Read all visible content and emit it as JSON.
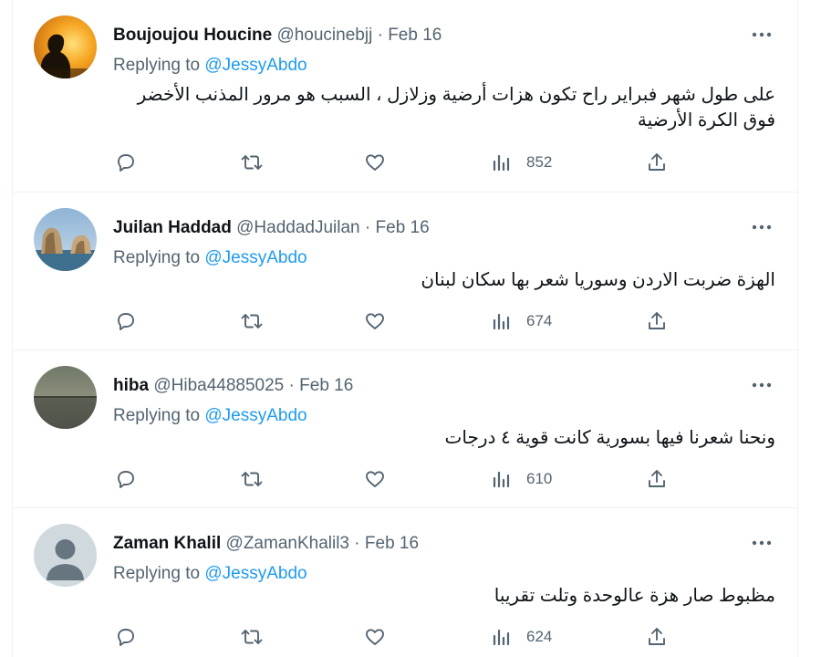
{
  "tweets": [
    {
      "name": "Boujoujou Houcine",
      "handle": "@houcinebjj",
      "date": "Feb 16",
      "replying_label": "Replying to",
      "replying_to": "@JessyAbdo",
      "text": "على طول شهر فبراير راح تكون هزات أرضية وزلازل ، السبب هو مرور المذنب الأخضر فوق الكرة الأرضية",
      "views": "852",
      "avatar": "silhouette-sunset"
    },
    {
      "name": "Juilan Haddad",
      "handle": "@HaddadJuilan",
      "date": "Feb 16",
      "replying_label": "Replying to",
      "replying_to": "@JessyAbdo",
      "text": "الهزة ضربت الاردن وسوريا شعر بها سكان لبنان",
      "views": "674",
      "avatar": "rock-sea"
    },
    {
      "name": "hiba",
      "handle": "@Hiba44885025",
      "date": "Feb 16",
      "replying_label": "Replying to",
      "replying_to": "@JessyAbdo",
      "text": "ونحنا شعرنا فيها بسورية كانت قوية ٤ درجات",
      "views": "610",
      "avatar": "sea-horizon"
    },
    {
      "name": "Zaman Khalil",
      "handle": "@ZamanKhalil3",
      "date": "Feb 16",
      "replying_label": "Replying to",
      "replying_to": "@JessyAbdo",
      "text": "مظبوط صار هزة عالوحدة وتلت تقريبا",
      "views": "624",
      "avatar": "default-profile"
    }
  ],
  "dot_separator": "·",
  "icons": {
    "more": "more-dots-icon",
    "reply": "reply-icon",
    "retweet": "retweet-icon",
    "like": "heart-icon",
    "views": "views-chart-icon",
    "share": "share-icon"
  },
  "colors": {
    "text": "#0f1419",
    "secondary": "#536471",
    "accent": "#1d9bf0",
    "border": "#eff3f4"
  }
}
